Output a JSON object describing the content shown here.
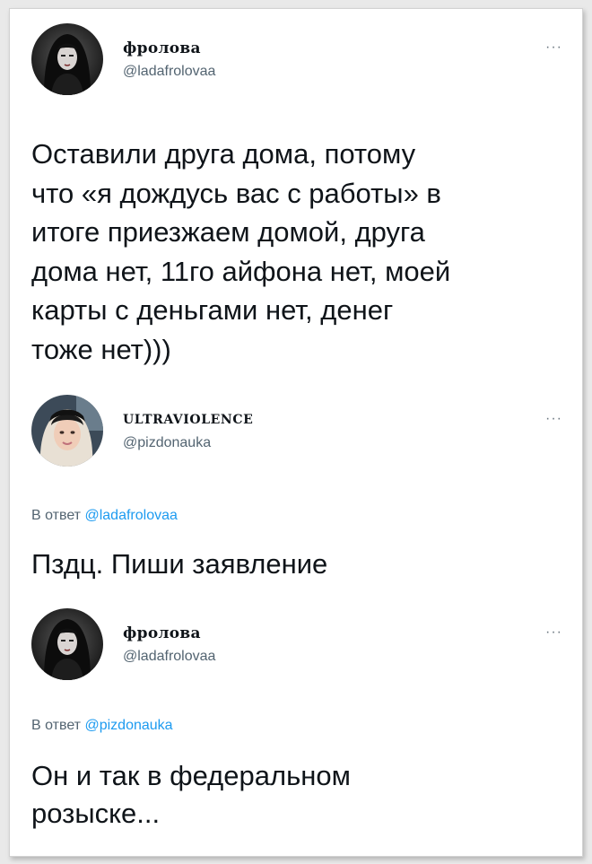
{
  "tweets": [
    {
      "display_name": "фролова",
      "handle": "@ladafrolovaa",
      "more_label": "···",
      "text": "Оставили друга дома, потому\nчто «я дождусь вас с работы» в\nитоге приезжаем домой, друга\nдома нет, 11го айфона нет, моей\nкарты с деньгами нет, денег\nтоже нет)))"
    },
    {
      "display_name": "ULTRAVIOLENCE",
      "handle": "@pizdonauka",
      "more_label": "···",
      "reply_prefix": "В ответ",
      "reply_to": "@ladafrolovaa",
      "text": "Пздц. Пиши заявление"
    },
    {
      "display_name": "фролова",
      "handle": "@ladafrolovaa",
      "more_label": "···",
      "reply_prefix": "В ответ",
      "reply_to": "@pizdonauka",
      "text": "Он и так в федеральном\nрозыске..."
    }
  ],
  "colors": {
    "text": "#0f1419",
    "secondary": "#536471",
    "link": "#1d9bf0",
    "background": "#e9e9e9",
    "card": "#ffffff"
  }
}
